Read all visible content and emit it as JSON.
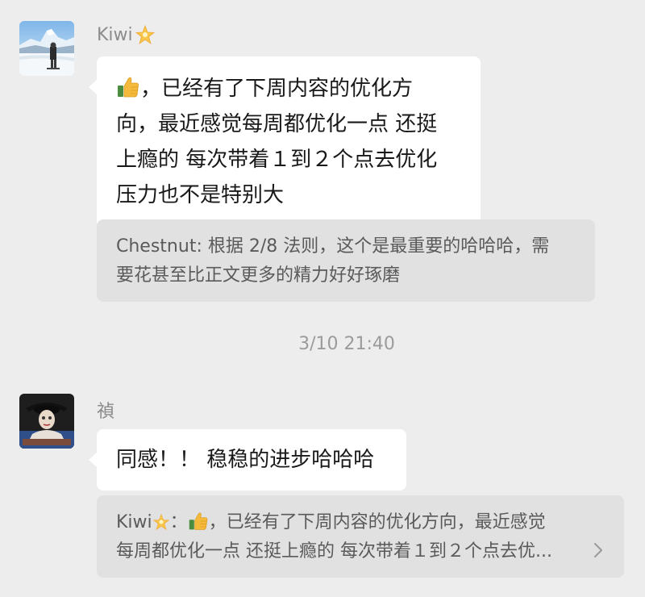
{
  "messages": [
    {
      "sender": "Kiwi",
      "sender_badge": "star-emoji",
      "lines": [
        "，已经有了下周内容的优化方",
        "向，最近感觉每周都优化一点 还挺",
        "上瘾的 每次带着１到２个点去优化",
        "压力也不是特别大"
      ],
      "leading_emoji": "thumbs-up-emoji",
      "quote": {
        "author": "Chestnut",
        "lines": [
          "Chestnut: 根据 2/8 法则，这个是最重要的哈哈哈，需",
          "要花甚至比正文更多的精力好好琢磨"
        ]
      }
    },
    {
      "sender": "禎",
      "lines": [
        "同感！！ 稳稳的进步哈哈哈"
      ],
      "quote": {
        "author": "Kiwi",
        "author_badge": "star-emoji",
        "line1_prefix": "Kiwi",
        "line1_suffix": "：",
        "line1_text": "，已经有了下周内容的优化方向，最近感觉",
        "line2_text": "每周都优化一点 还挺上瘾的 每次带着１到２个点去优..."
      }
    }
  ],
  "timestamp": "3/10 21:40",
  "colors": {
    "background": "#ededed",
    "bubble": "#ffffff",
    "quote_background": "#e1e1e1",
    "name_text": "#8c8c8c",
    "quote_text": "#5a5a5a"
  }
}
